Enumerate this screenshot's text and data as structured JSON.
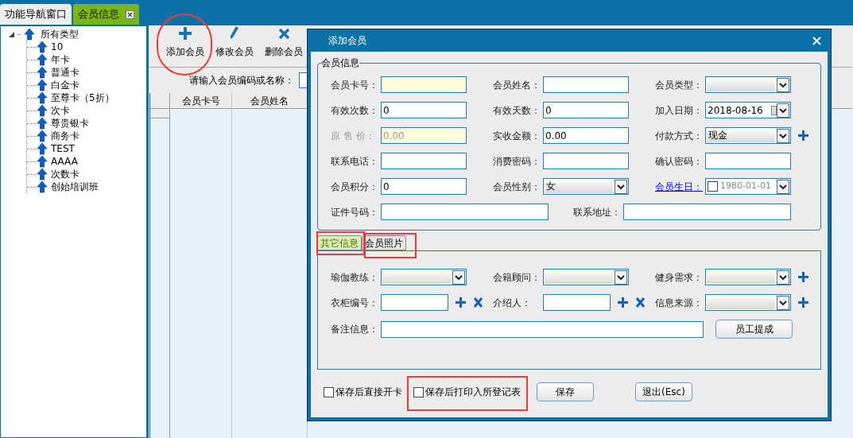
{
  "nav_tabs": [
    {
      "label": "功能导航窗口",
      "selected": false,
      "closable": false
    },
    {
      "label": "会员信息",
      "selected": true,
      "closable": true
    }
  ],
  "tree": {
    "label": "所有类型",
    "expanded": true,
    "children": [
      {
        "label": "10"
      },
      {
        "label": "年卡"
      },
      {
        "label": "普通卡"
      },
      {
        "label": "白金卡"
      },
      {
        "label": "至尊卡（5折）"
      },
      {
        "label": "次卡"
      },
      {
        "label": "尊贵银卡"
      },
      {
        "label": "商务卡"
      },
      {
        "label": "TEST"
      },
      {
        "label": "AAAA"
      },
      {
        "label": "次数卡"
      },
      {
        "label": "创始培训班"
      }
    ]
  },
  "toolbar": [
    {
      "label": "添加会员",
      "kind": "add"
    },
    {
      "label": "修改会员",
      "kind": "edit"
    },
    {
      "label": "删除会员",
      "kind": "delete"
    }
  ],
  "search": {
    "label": "请输入会员编码或名称："
  },
  "table": {
    "columns": [
      "会员卡号",
      "会员姓名"
    ]
  },
  "dialog": {
    "title": "添加会员",
    "section_title": "会员信息",
    "rows": [
      [
        {
          "label": "会员卡号：",
          "kind": "text",
          "highlighted": true
        },
        {
          "label": "会员姓名：",
          "kind": "text"
        },
        {
          "label": "会员类型：",
          "kind": "select"
        }
      ],
      [
        {
          "label": "有效次数：",
          "kind": "text",
          "value": "0"
        },
        {
          "label": "有效天数：",
          "kind": "text",
          "value": "0"
        },
        {
          "label": "加入日期：",
          "kind": "date",
          "value": "2018-08-16"
        }
      ],
      [
        {
          "label": "原 售 价：",
          "kind": "text",
          "value": "0.00",
          "highlighted": true,
          "disabled": true
        },
        {
          "label": "实收金额：",
          "kind": "text",
          "value": "0.00"
        },
        {
          "label": "付款方式：",
          "kind": "select",
          "value": "现金",
          "add_button": true
        }
      ],
      [
        {
          "label": "联系电话：",
          "kind": "text"
        },
        {
          "label": "消费密码：",
          "kind": "text"
        },
        {
          "label": "确认密码：",
          "kind": "text"
        }
      ],
      [
        {
          "label": "会员积分：",
          "kind": "text",
          "value": "0"
        },
        {
          "label": "会员性别：",
          "kind": "select",
          "value": "女"
        },
        {
          "label": "会员生日：",
          "kind": "checkdate",
          "value": "1980-01-01",
          "link": true,
          "checked": false
        }
      ],
      [
        {
          "label": "证件号码：",
          "kind": "text",
          "wide": true
        },
        {
          "label": "联系地址：",
          "kind": "text",
          "wide": true
        }
      ]
    ],
    "tabs": [
      {
        "label": "其它信息",
        "selected": true
      },
      {
        "label": "会员照片",
        "selected": false
      }
    ],
    "other_rows": [
      [
        {
          "label": "瑜伽教练：",
          "kind": "select"
        },
        {
          "label": "会籍顾问：",
          "kind": "select"
        },
        {
          "label": "健身需求：",
          "kind": "select",
          "add_button": true
        }
      ],
      [
        {
          "label": "衣柜编号：",
          "kind": "text",
          "short": true,
          "add_button": true,
          "remove_button": true
        },
        {
          "label": "介绍人：",
          "kind": "text",
          "short": true,
          "add_button": true,
          "remove_button": true
        },
        {
          "label": "信息来源：",
          "kind": "select",
          "add_button": true
        }
      ],
      [
        {
          "label": "备注信息：",
          "kind": "text",
          "long": true,
          "button": "员工提成"
        }
      ]
    ],
    "checkboxes": [
      {
        "label": "保存后直接开卡",
        "checked": false
      },
      {
        "label": "保存后打印入所登记表",
        "checked": false
      }
    ],
    "buttons": [
      "保存",
      "退出(Esc)"
    ]
  }
}
